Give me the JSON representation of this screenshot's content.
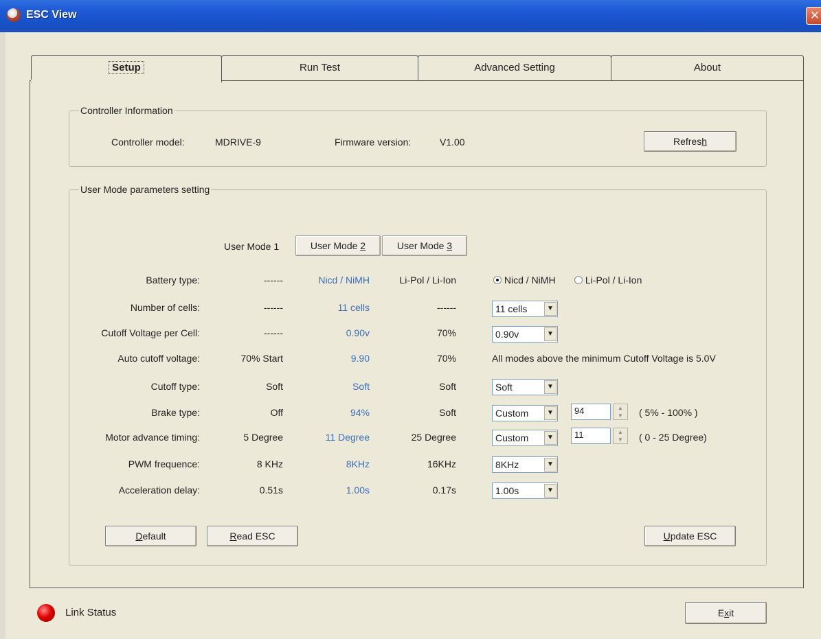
{
  "window": {
    "title": "ESC View",
    "close_glyph": "✕",
    "app_icon": "app-logo-icon"
  },
  "tabs": [
    {
      "label": "Setup",
      "active": true
    },
    {
      "label": "Run Test",
      "active": false
    },
    {
      "label": "Advanced Setting",
      "active": false
    },
    {
      "label": "About",
      "active": false
    }
  ],
  "controller_info": {
    "legend": "Controller Information",
    "model_label": "Controller model:",
    "model_value": "MDRIVE-9",
    "firmware_label": "Firmware version:",
    "firmware_value": "V1.00",
    "refresh_pre": "Refres",
    "refresh_key": "h"
  },
  "user_mode": {
    "legend": "User Mode parameters setting",
    "mode1_label": "User Mode 1",
    "mode2_pre": "User Mode ",
    "mode2_key": "2",
    "mode3_pre": "User Mode ",
    "mode3_key": "3",
    "rows": [
      {
        "label": "Battery type:",
        "m1": "------",
        "m2": "Nicd / NiMH",
        "m3": "Li-Pol / Li-Ion"
      },
      {
        "label": "Number of cells:",
        "m1": "------",
        "m2": "11 cells",
        "m3": "------",
        "select": "11 cells"
      },
      {
        "label": "Cutoff Voltage per Cell:",
        "m1": "------",
        "m2": "0.90v",
        "m3": "70%",
        "select": "0.90v"
      },
      {
        "label": "Auto cutoff voltage:",
        "m1": "70% Start",
        "m2": "9.90",
        "m3": "70%",
        "note": "All modes above the minimum Cutoff Voltage is 5.0V"
      },
      {
        "label": "Cutoff type:",
        "m1": "Soft",
        "m2": "Soft",
        "m3": "Soft",
        "select": "Soft"
      },
      {
        "label": "Brake type:",
        "m1": "Off",
        "m2": "94%",
        "m3": "Soft",
        "select": "Custom",
        "spin": "94",
        "range": "( 5% - 100% )"
      },
      {
        "label": "Motor advance timing:",
        "m1": "5 Degree",
        "m2": "11 Degree",
        "m3": "25 Degree",
        "select": "Custom",
        "spin": "11",
        "range": "( 0 - 25 Degree)"
      },
      {
        "label": "PWM frequence:",
        "m1": "8 KHz",
        "m2": "8KHz",
        "m3": "16KHz",
        "select": "8KHz"
      },
      {
        "label": "Acceleration delay:",
        "m1": "0.51s",
        "m2": "1.00s",
        "m3": "0.17s",
        "select": "1.00s"
      }
    ],
    "battery_radio": {
      "option1": "Nicd / NiMH",
      "option2": "Li-Pol / Li-Ion",
      "selected": "Nicd / NiMH"
    },
    "default_key": "D",
    "default_rest": "efault",
    "read_key": "R",
    "read_rest": "ead ESC",
    "update_key": "U",
    "update_rest": "pdate ESC"
  },
  "footer": {
    "link_status": "Link Status",
    "link_status_color": "#e00000",
    "exit_pre": "E",
    "exit_key": "x",
    "exit_post": "it"
  }
}
